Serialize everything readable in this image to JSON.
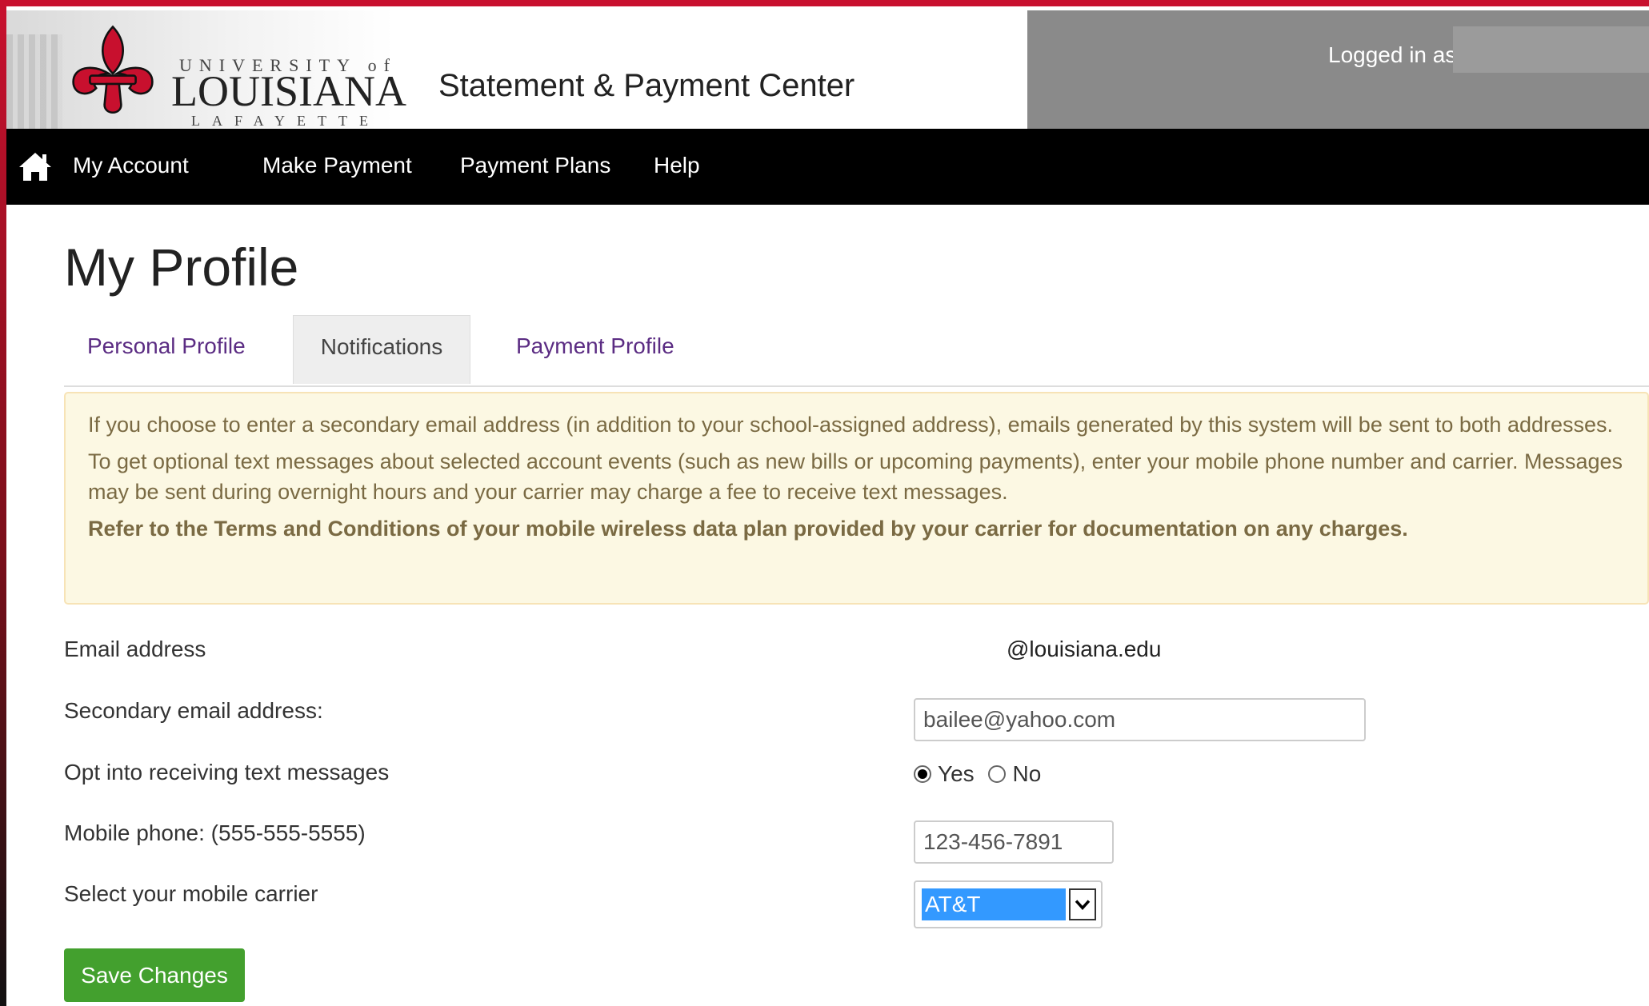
{
  "header": {
    "logo": {
      "top": "UNIVERSITY of",
      "main": "LOUISIANA",
      "bottom": "LAFAYETTE"
    },
    "site_title": "Statement & Payment Center",
    "logged_in_label": "Logged in as"
  },
  "nav": {
    "home_icon": "home-icon",
    "items": [
      "My Account",
      "Make Payment",
      "Payment Plans",
      "Help"
    ]
  },
  "page": {
    "title": "My Profile"
  },
  "tabs": {
    "personal": "Personal Profile",
    "notifications": "Notifications",
    "payment": "Payment Profile"
  },
  "notice": {
    "line1": "If you choose to enter a secondary email address (in addition to your school-assigned address), emails generated by this system will be sent to both addresses.",
    "line2": "To get optional text messages about selected account events (such as new bills or upcoming payments), enter your mobile phone number and carrier. Messages may be sent during overnight hours and your carrier may charge a fee to receive text messages.",
    "line3": "Refer to the Terms and Conditions of your mobile wireless data plan provided by your carrier for documentation on any charges."
  },
  "form": {
    "email_label": "Email address",
    "email_value": "@louisiana.edu",
    "secondary_email_label": "Secondary email address:",
    "secondary_email_value": "bailee@yahoo.com",
    "text_opt_label": "Opt into receiving text messages",
    "opt_yes": "Yes",
    "opt_no": "No",
    "opt_selected": "Yes",
    "phone_label": "Mobile phone: (555-555-5555)",
    "phone_value": "123-456-7891",
    "carrier_label": "Select your mobile carrier",
    "carrier_selected": "AT&T",
    "save_label": "Save Changes"
  },
  "colors": {
    "nav_bg": "#000000",
    "brand_red": "#c8102e",
    "tab_link": "#5b2c83",
    "notice_bg": "#fcf8e3",
    "save_green": "#43a02e",
    "select_highlight": "#3399ff"
  }
}
